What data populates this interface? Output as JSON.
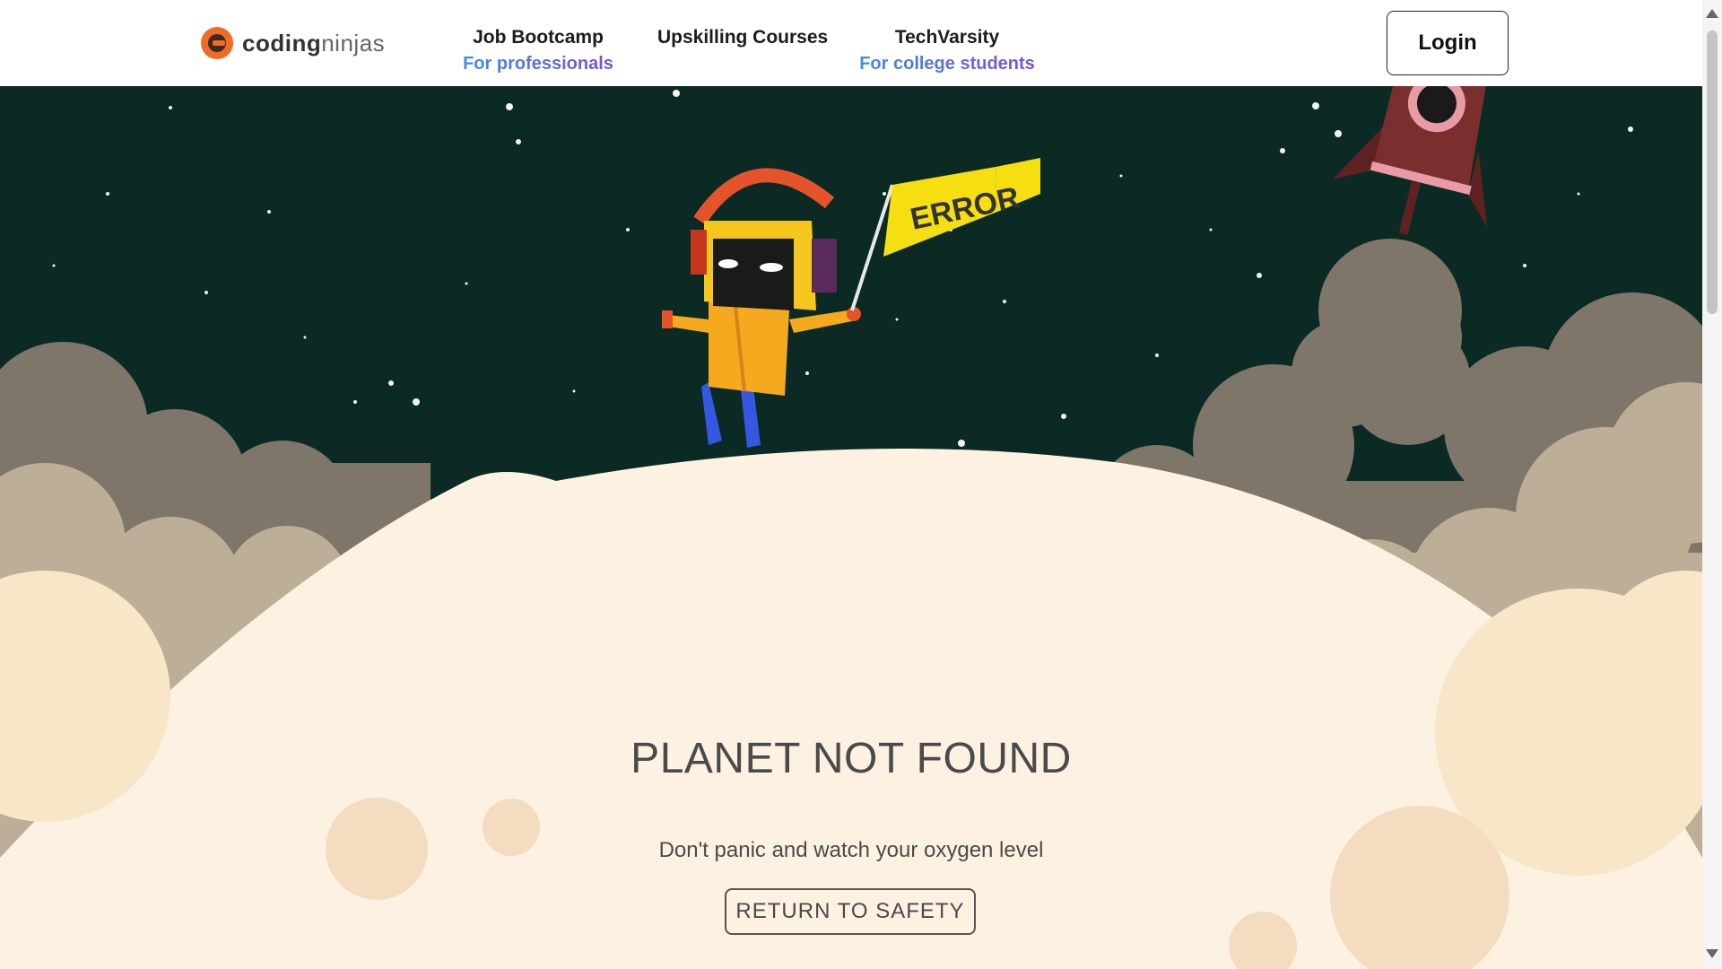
{
  "brand": {
    "logo_light": "coding",
    "logo_bold": "ninjas"
  },
  "nav": [
    {
      "title": "Job Bootcamp",
      "subtitle": "For professionals"
    },
    {
      "title": "Upskilling Courses",
      "subtitle": ""
    },
    {
      "title": "TechVarsity",
      "subtitle": "For college students"
    }
  ],
  "header": {
    "login_label": "Login"
  },
  "illustration": {
    "flag_text": "ERROR"
  },
  "main": {
    "title": "PLANET NOT FOUND",
    "subtitle": "Don't panic and watch your oxygen level",
    "button_label": "RETURN TO SAFETY"
  },
  "colors": {
    "space": "#0b2a24",
    "planet": "#fdf2e2",
    "accent_orange": "#f26b25",
    "nav_gradient_start": "#3e8de0",
    "nav_gradient_end": "#7c4fd6"
  },
  "icons": [
    "coding-ninjas-logo-icon",
    "robot-astronaut-illustration",
    "rocket-icon",
    "error-flag-icon"
  ]
}
